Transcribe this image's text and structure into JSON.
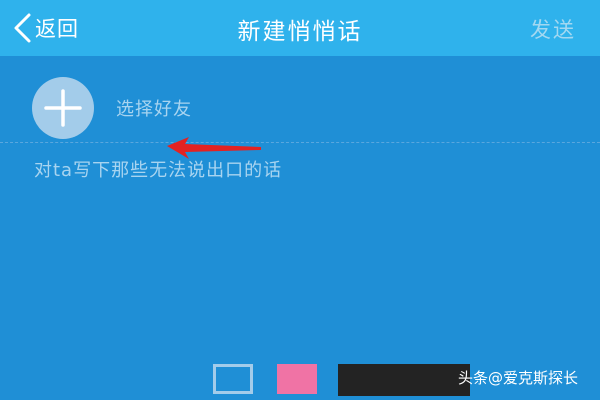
{
  "header": {
    "back_label": "返回",
    "title": "新建悄悄话",
    "send_label": "发送"
  },
  "friend_picker": {
    "label": "选择好友",
    "icon": "plus-icon"
  },
  "message": {
    "placeholder": "对ta写下那些无法说出口的话"
  },
  "annotation": {
    "arrow_color": "#e32222"
  },
  "watermark": {
    "text": "头条@爱克斯探长"
  },
  "colors": {
    "background": "#1f8fd6",
    "header": "#2fb2ec",
    "pink_swatch": "#f073a5"
  }
}
